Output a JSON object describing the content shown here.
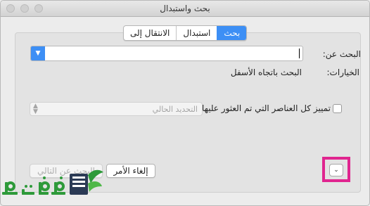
{
  "window": {
    "title": "بحث واستبدال"
  },
  "tabs": [
    {
      "label": "بحث",
      "active": true
    },
    {
      "label": "استبدال",
      "active": false
    },
    {
      "label": "الانتقال إلى",
      "active": false
    }
  ],
  "search": {
    "label": "البحث عن:",
    "value": "",
    "placeholder": ""
  },
  "options": {
    "label": "الخيارات:",
    "value": "البحث باتجاه الأسفل"
  },
  "highlight": {
    "checkbox_label": "تمييز كل العناصر التي تم العثور عليها في:",
    "checked": false
  },
  "scope_select": {
    "value": "التحديد الحالي"
  },
  "buttons": {
    "cancel": "إلغاء الأمر",
    "find_next": "البحث عن التالي"
  },
  "watermark": {
    "text": "فكرة"
  },
  "colors": {
    "accent": "#3d8ff5",
    "highlight_frame": "#e0258f",
    "logo_green": "#2e9a3a"
  }
}
